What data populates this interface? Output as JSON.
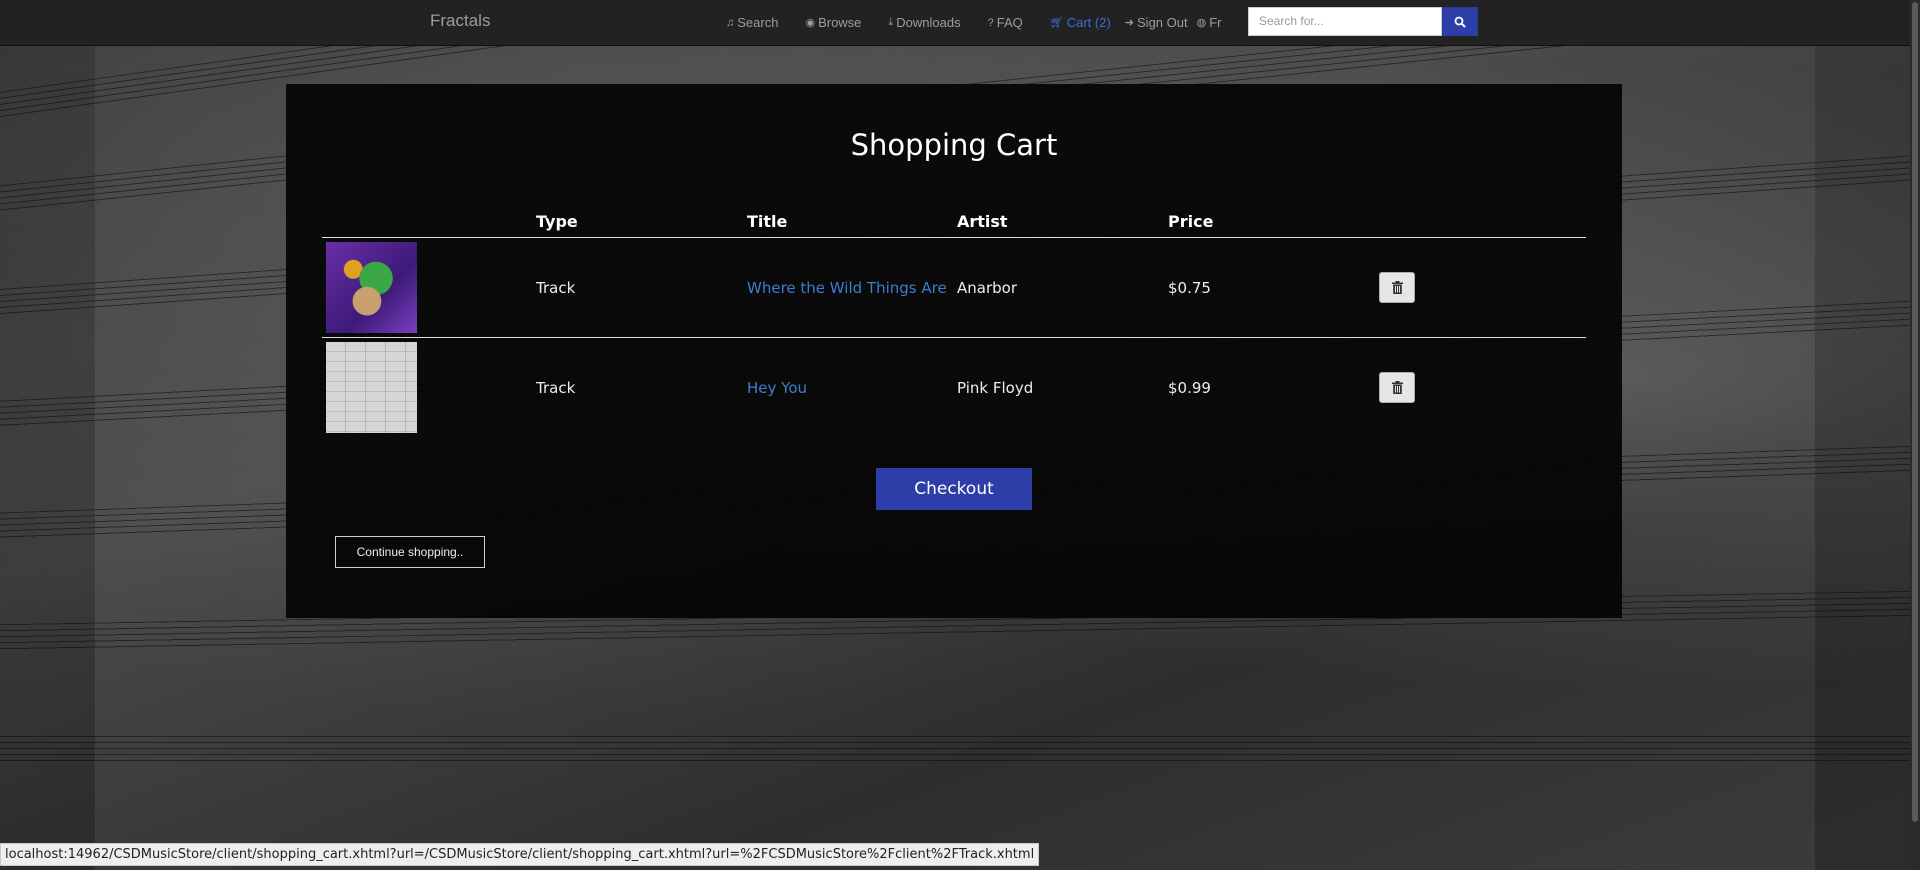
{
  "navbar": {
    "brand": "Fractals",
    "links": [
      {
        "label": "Search",
        "icon": "music-icon"
      },
      {
        "label": "Browse",
        "icon": "eye-icon"
      },
      {
        "label": "Downloads",
        "icon": "download-icon"
      },
      {
        "label": "FAQ",
        "icon": "question-circle-icon"
      },
      {
        "label": "Cart (2)",
        "icon": "shopping-cart-icon",
        "active": true
      },
      {
        "label": "Sign Out",
        "icon": "sign-out-icon"
      },
      {
        "label": "Fr",
        "icon": "globe-icon"
      }
    ],
    "search": {
      "placeholder": "Search for..."
    }
  },
  "cart": {
    "title": "Shopping Cart",
    "columns": [
      "",
      "Type",
      "Title",
      "Artist",
      "Price",
      ""
    ],
    "items": [
      {
        "type": "Track",
        "title": "Where the Wild Things Are",
        "artist": "Anarbor",
        "price": "$0.75"
      },
      {
        "type": "Track",
        "title": "Hey You",
        "artist": "Pink Floyd",
        "price": "$0.99"
      }
    ],
    "checkout_label": "Checkout",
    "continue_label": "Continue shopping.."
  },
  "statusbar": {
    "url": "localhost:14962/CSDMusicStore/client/shopping_cart.xhtml?url=/CSDMusicStore/client/shopping_cart.xhtml?url=%2FCSDMusicStore%2Fclient%2FTrack.xhtml"
  },
  "colors": {
    "accent": "#2d3ea8",
    "link": "#3b7ed0",
    "navbar": "#222222"
  }
}
